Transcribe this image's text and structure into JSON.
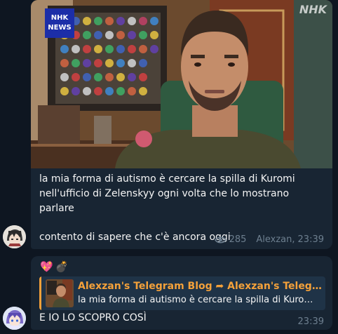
{
  "message1": {
    "video_watermark_logo": "NHK NEWS",
    "video_watermark_corner": "NHK",
    "lines": [
      "la mia forma di autismo è cercare la spilla di Kuromi",
      "nell'ufficio di Zelenskyy ogni volta che lo mostrano parlare",
      "",
      "contento di sapere che c'è ancora oggi"
    ],
    "views": "285",
    "author": "Alexzan,",
    "time": "23:39"
  },
  "message2": {
    "reactions": [
      {
        "emoji": "💖",
        "icon": "sparkling-heart-icon"
      },
      {
        "emoji": "💣",
        "icon": "bomb-icon"
      }
    ],
    "reply": {
      "title": "Alexzan's Telegram Blog ➦ Alexzan's Telegram Blog",
      "text": "la mia forma di autismo è cercare la spilla di Kuromi nell'ufficio di Zelenskyy"
    },
    "text": "E IO LO SCOPRO COSÌ",
    "time": "23:39"
  },
  "colors": {
    "background": "#0e1621",
    "bubble": "#182533",
    "accent": "#f4a13a",
    "meta": "#6d7f8f"
  }
}
